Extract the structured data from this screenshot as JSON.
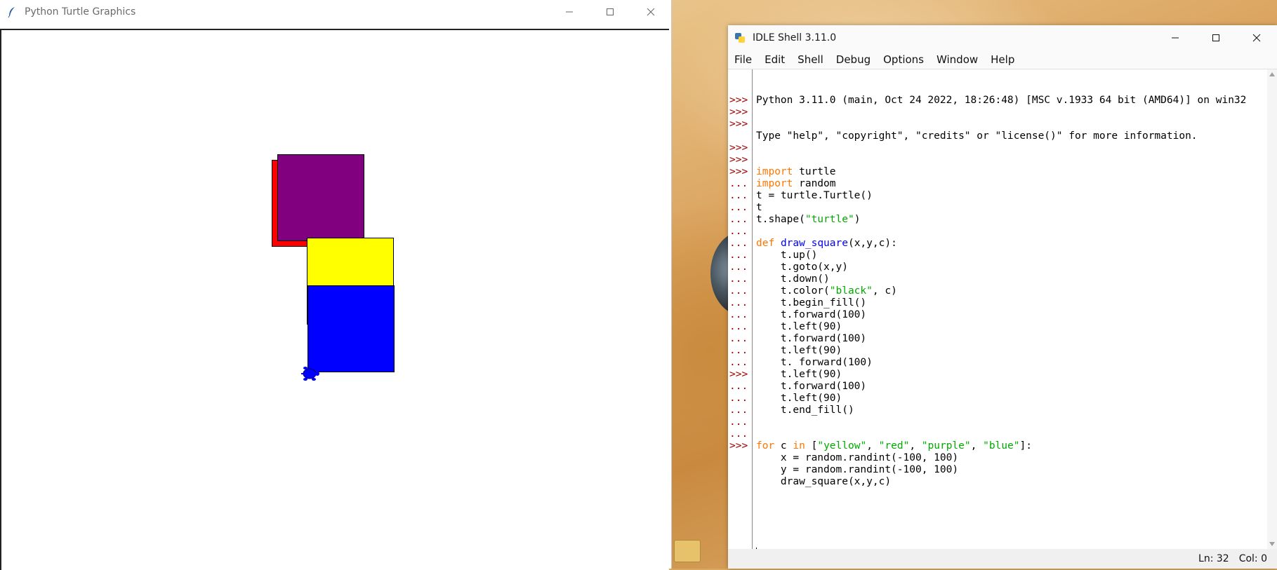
{
  "turtle_window": {
    "title": "Python Turtle Graphics",
    "squares": [
      {
        "name": "red",
        "color": "#ff0000"
      },
      {
        "name": "purple",
        "color": "#800080"
      },
      {
        "name": "yellow",
        "color": "#ffff00"
      },
      {
        "name": "blue",
        "color": "#0000ff"
      }
    ],
    "turtle_color": "#0000ff"
  },
  "idle_window": {
    "title": "IDLE Shell 3.11.0",
    "menu": [
      "File",
      "Edit",
      "Shell",
      "Debug",
      "Options",
      "Window",
      "Help"
    ],
    "status": {
      "line": "Ln: 32",
      "col": "Col: 0"
    },
    "banner": [
      "Python 3.11.0 (main, Oct 24 2022, 18:26:48) [MSC v.1933 64 bit (AMD64)] on win32",
      "Type \"help\", \"copyright\", \"credits\" or \"license()\" for more information."
    ],
    "prompts": [
      "",
      "",
      ">>>",
      ">>>",
      ">>>",
      "",
      ">>>",
      ">>>",
      ">>>",
      "...",
      "...",
      "...",
      "...",
      "...",
      "...",
      "...",
      "...",
      "...",
      "...",
      "...",
      "...",
      "...",
      "...",
      "...",
      "...",
      ">>>",
      "...",
      "...",
      "...",
      "...",
      "...",
      ">>>"
    ],
    "code_lines": [
      [
        {
          "t": "import",
          "c": "kw"
        },
        {
          "t": " turtle"
        }
      ],
      [
        {
          "t": "import",
          "c": "kw"
        },
        {
          "t": " random"
        }
      ],
      [
        {
          "t": "t = turtle.Turtle()"
        }
      ],
      [
        {
          "t": "t"
        }
      ],
      [
        {
          "t": "t.shape("
        },
        {
          "t": "\"turtle\"",
          "c": "str"
        },
        {
          "t": ")"
        }
      ],
      [
        {
          "t": ""
        }
      ],
      [
        {
          "t": "def",
          "c": "kw"
        },
        {
          "t": " "
        },
        {
          "t": "draw_square",
          "c": "fn"
        },
        {
          "t": "(x,y,c):"
        }
      ],
      [
        {
          "t": "    t.up()"
        }
      ],
      [
        {
          "t": "    t.goto(x,y)"
        }
      ],
      [
        {
          "t": "    t.down()"
        }
      ],
      [
        {
          "t": "    t.color("
        },
        {
          "t": "\"black\"",
          "c": "str"
        },
        {
          "t": ", c)"
        }
      ],
      [
        {
          "t": "    t.begin_fill()"
        }
      ],
      [
        {
          "t": "    t.forward(100)"
        }
      ],
      [
        {
          "t": "    t.left(90)"
        }
      ],
      [
        {
          "t": "    t.forward(100)"
        }
      ],
      [
        {
          "t": "    t.left(90)"
        }
      ],
      [
        {
          "t": "    t. forward(100)"
        }
      ],
      [
        {
          "t": "    t.left(90)"
        }
      ],
      [
        {
          "t": "    t.forward(100)"
        }
      ],
      [
        {
          "t": "    t.left(90)"
        }
      ],
      [
        {
          "t": "    t.end_fill()"
        }
      ],
      [
        {
          "t": ""
        }
      ],
      [
        {
          "t": ""
        }
      ],
      [
        {
          "t": "for",
          "c": "kw"
        },
        {
          "t": " c "
        },
        {
          "t": "in",
          "c": "kw"
        },
        {
          "t": " ["
        },
        {
          "t": "\"yellow\"",
          "c": "str"
        },
        {
          "t": ", "
        },
        {
          "t": "\"red\"",
          "c": "str"
        },
        {
          "t": ", "
        },
        {
          "t": "\"purple\"",
          "c": "str"
        },
        {
          "t": ", "
        },
        {
          "t": "\"blue\"",
          "c": "str"
        },
        {
          "t": "]:"
        }
      ],
      [
        {
          "t": "    x = random.randint(-100, 100)"
        }
      ],
      [
        {
          "t": "    y = random.randint(-100, 100)"
        }
      ],
      [
        {
          "t": "    draw_square(x,y,c)"
        }
      ],
      [
        {
          "t": ""
        }
      ],
      [
        {
          "t": ""
        }
      ],
      [
        {
          "t": ""
        }
      ]
    ]
  }
}
